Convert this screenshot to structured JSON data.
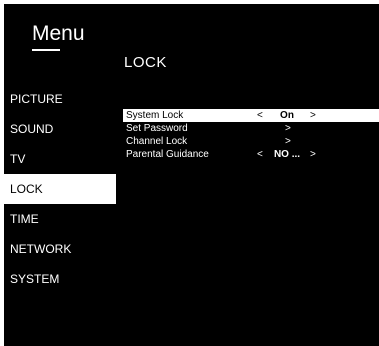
{
  "menu": {
    "title": "Menu"
  },
  "page": {
    "title": "LOCK"
  },
  "sidebar": {
    "items": [
      {
        "label": "PICTURE",
        "active": false
      },
      {
        "label": "SOUND",
        "active": false
      },
      {
        "label": "TV",
        "active": false
      },
      {
        "label": "LOCK",
        "active": true
      },
      {
        "label": "TIME",
        "active": false
      },
      {
        "label": "NETWORK",
        "active": false
      },
      {
        "label": "SYSTEM",
        "active": false
      }
    ]
  },
  "options": [
    {
      "label": "System Lock",
      "left_arrow": "<",
      "value": "On",
      "right_arrow": ">",
      "selected": true
    },
    {
      "label": "Set Password",
      "right_arrow": ">"
    },
    {
      "label": "Channel Lock",
      "right_arrow": ">"
    },
    {
      "label": "Parental Guidance",
      "left_arrow": "<",
      "value": "NO ...",
      "right_arrow": ">"
    }
  ],
  "colors": {
    "background": "#000000",
    "text": "#ffffff",
    "highlight": "#ffffff",
    "highlight_text": "#000000"
  }
}
